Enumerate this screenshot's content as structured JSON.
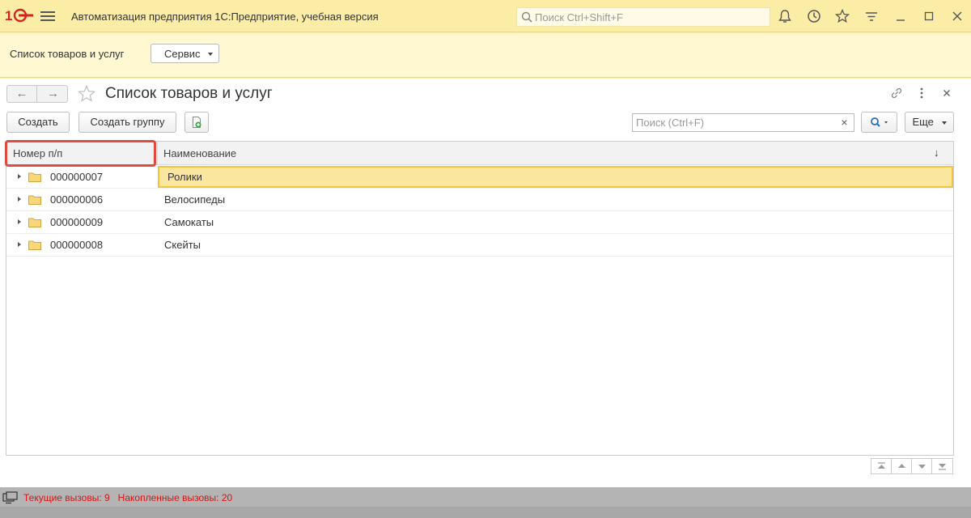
{
  "window": {
    "app_title": "Автоматизация предприятия 1С:Предприятие, учебная версия",
    "global_search_placeholder": "Поиск Ctrl+Shift+F",
    "logo_text": "1С"
  },
  "section": {
    "label": "Список товаров и услуг",
    "service_button": "Сервис"
  },
  "form": {
    "title": "Список товаров и услуг",
    "buttons": {
      "create": "Создать",
      "create_group": "Создать группу",
      "more": "Еще"
    },
    "search_placeholder": "Поиск (Ctrl+F)",
    "search_clear": "×"
  },
  "table": {
    "columns": [
      "Номер п/п",
      "Наименование"
    ],
    "sort_indicator": "↓",
    "rows": [
      {
        "code": "000000007",
        "name": "Ролики",
        "selected": true
      },
      {
        "code": "000000006",
        "name": "Велосипеды",
        "selected": false
      },
      {
        "code": "000000009",
        "name": "Самокаты",
        "selected": false
      },
      {
        "code": "000000008",
        "name": "Скейты",
        "selected": false
      }
    ]
  },
  "status": {
    "text": "Текущие вызовы: 9   Накопленные вызовы: 20"
  },
  "colors": {
    "accent_yellow": "#fbeda6",
    "selection": "#fbe6a0",
    "highlight_red": "#e04a3f",
    "status_red": "#e01010"
  }
}
